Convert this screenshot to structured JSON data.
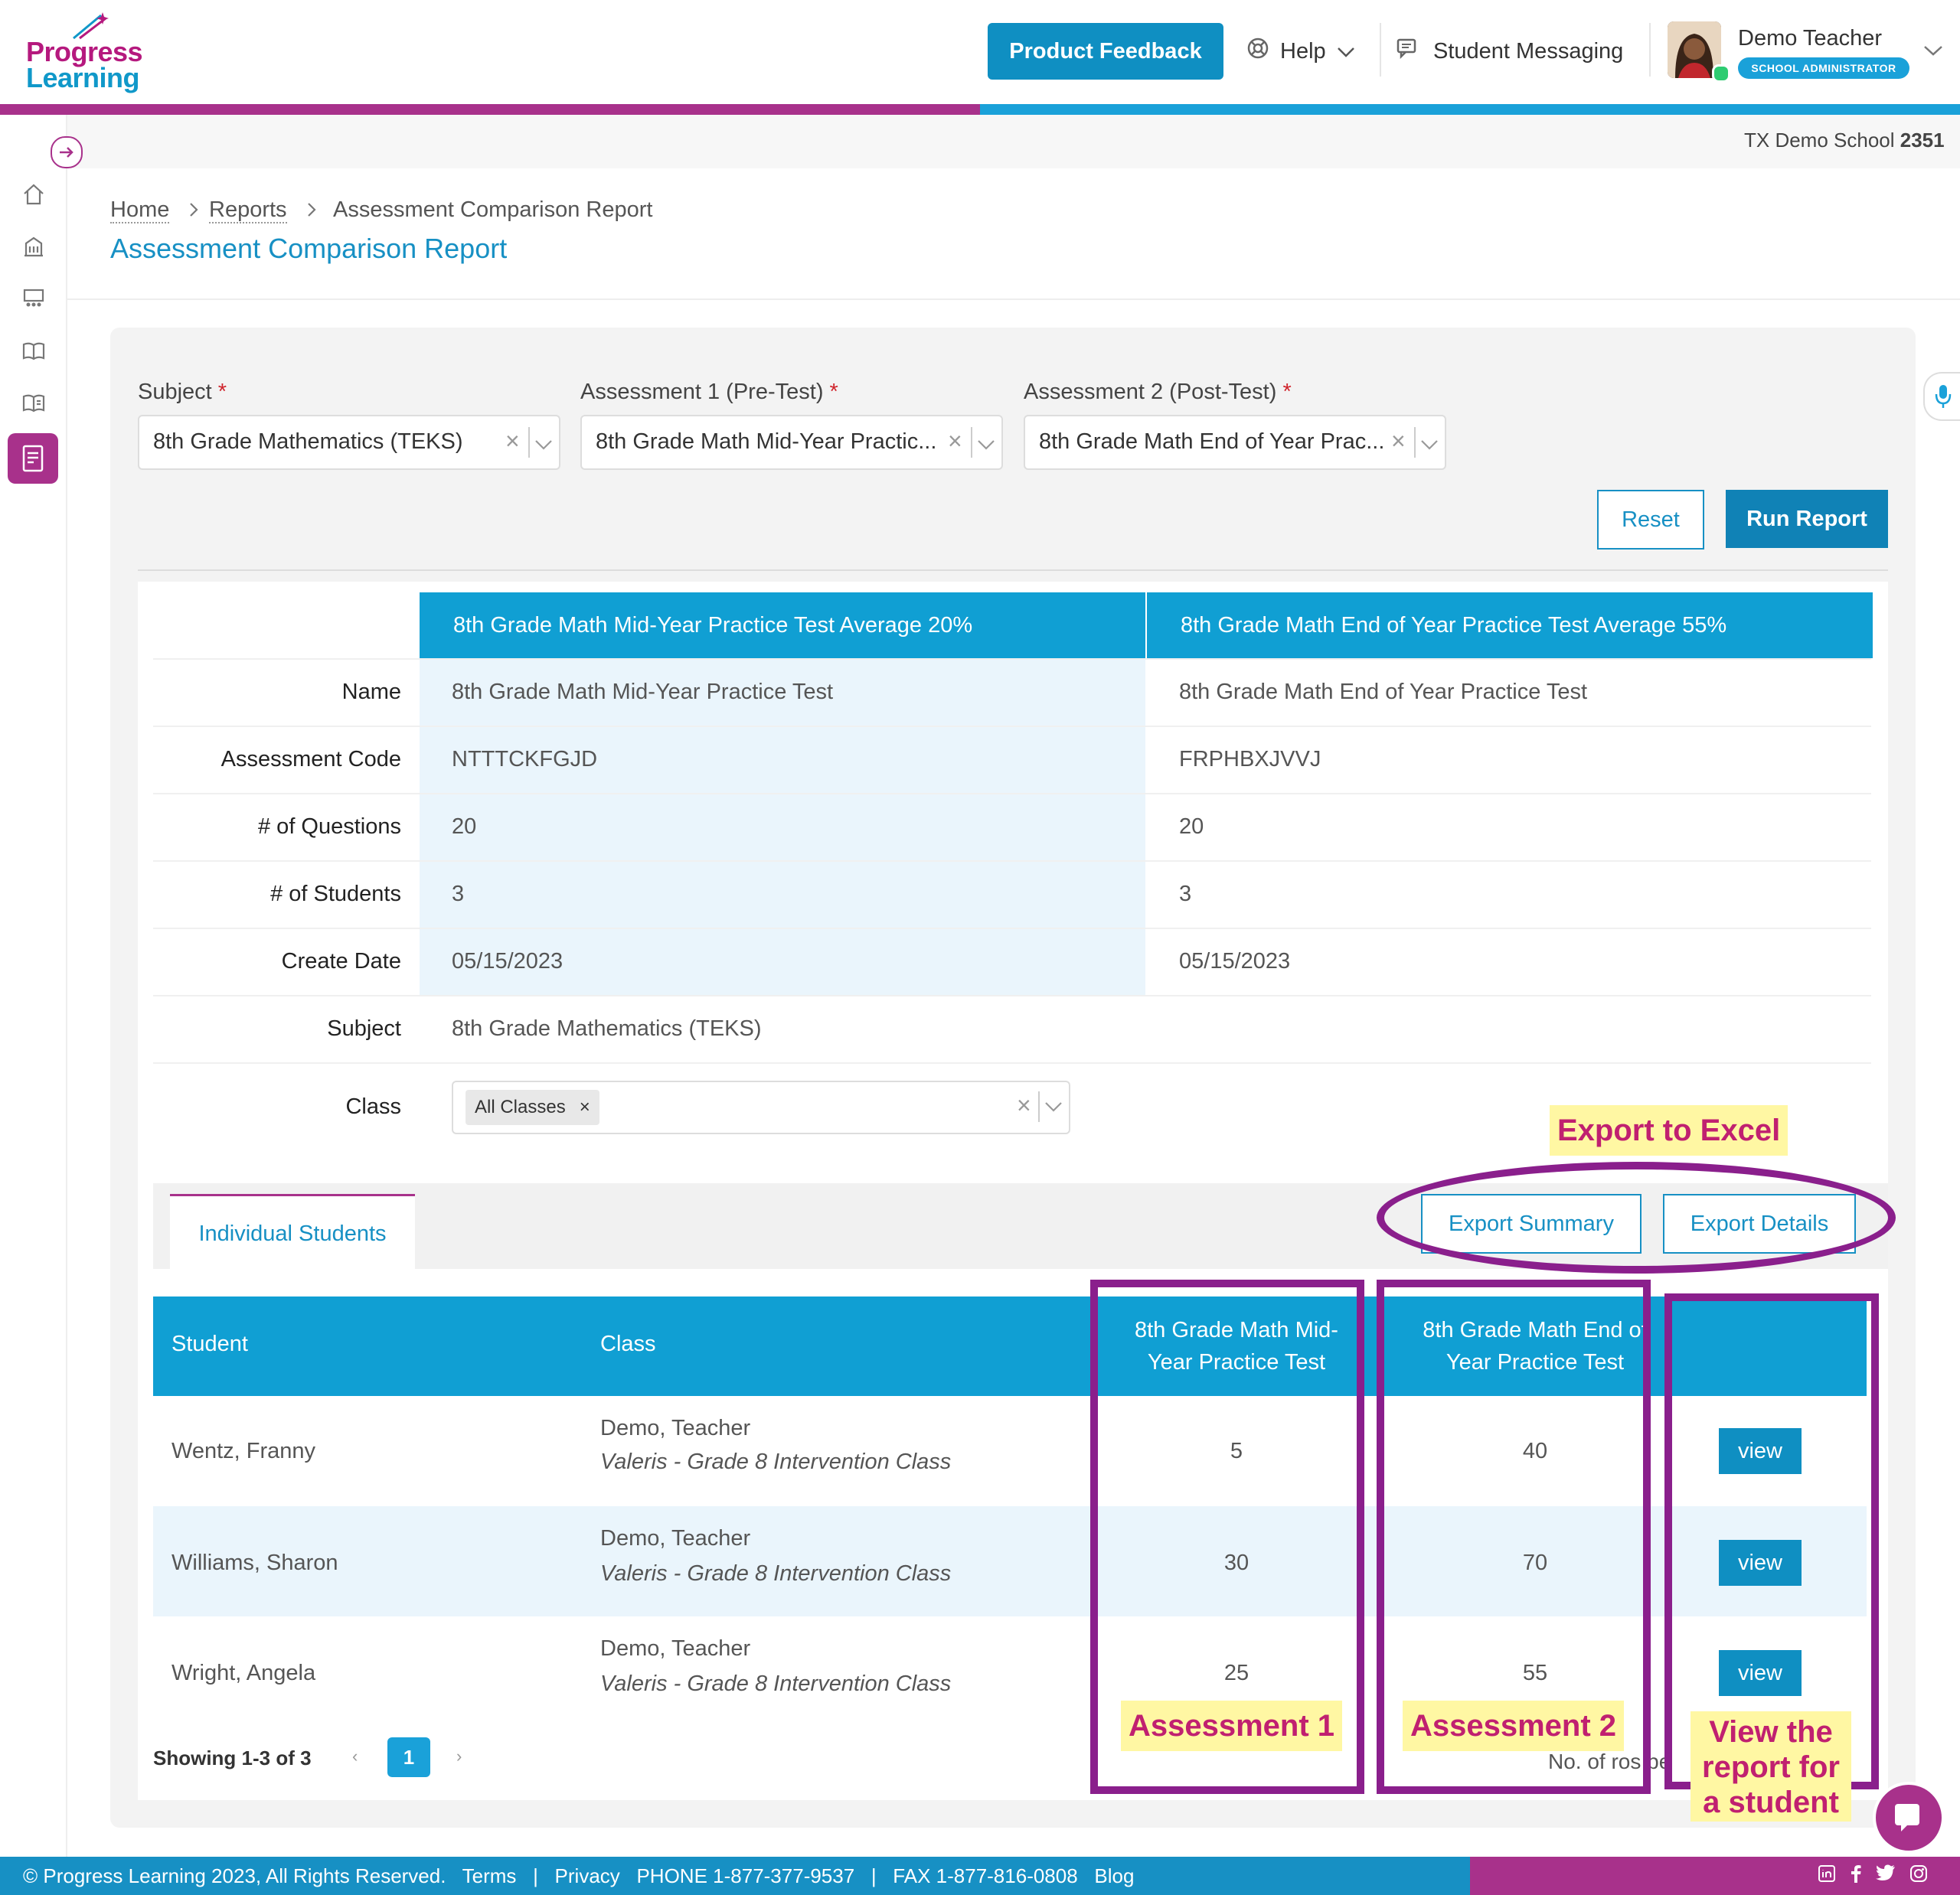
{
  "header": {
    "logo_top": "Progress",
    "logo_bottom": "Learning",
    "feedback_label": "Product Feedback",
    "help_label": "Help",
    "messaging_label": "Student Messaging",
    "user_name": "Demo Teacher",
    "user_role": "SCHOOL ADMINISTRATOR",
    "school_prefix": "TX Demo School",
    "school_number": "2351"
  },
  "breadcrumb": {
    "home": "Home",
    "reports": "Reports",
    "current": "Assessment Comparison Report"
  },
  "page_title": "Assessment Comparison Report",
  "filters": {
    "subject_label": "Subject",
    "subject_value": "8th Grade Mathematics (TEKS)",
    "a1_label": "Assessment 1 (Pre-Test)",
    "a1_value": "8th Grade Math Mid-Year Practic...",
    "a2_label": "Assessment 2 (Post-Test)",
    "a2_value": "8th Grade Math End of Year Prac...",
    "required_mark": "*",
    "reset_label": "Reset",
    "run_label": "Run Report"
  },
  "comparison": {
    "col_a_header": "8th Grade Math Mid-Year Practice Test Average 20%",
    "col_b_header": "8th Grade Math End of Year Practice Test Average 55%",
    "rows": [
      {
        "label": "Name",
        "a": "8th Grade Math Mid-Year Practice Test",
        "b": "8th Grade Math End of Year Practice Test"
      },
      {
        "label": "Assessment Code",
        "a": "NTTTCKFGJD",
        "b": "FRPHBXJVVJ"
      },
      {
        "label": "# of Questions",
        "a": "20",
        "b": "20"
      },
      {
        "label": "# of Students",
        "a": "3",
        "b": "3"
      },
      {
        "label": "Create Date",
        "a": "05/15/2023",
        "b": "05/15/2023"
      }
    ],
    "subject_label": "Subject",
    "subject_value": "8th Grade Mathematics (TEKS)",
    "class_label": "Class",
    "class_chip": "All Classes"
  },
  "tabs": {
    "individual": "Individual Students"
  },
  "exports": {
    "summary": "Export Summary",
    "details": "Export Details"
  },
  "students_table": {
    "headers": {
      "student": "Student",
      "class": "Class",
      "a1_line1": "8th Grade Math Mid-",
      "a1_line2": "Year Practice Test",
      "a2_line1": "8th Grade Math End of",
      "a2_line2": "Year Practice Test"
    },
    "rows": [
      {
        "name": "Wentz, Franny",
        "teacher": "Demo, Teacher",
        "class": "Valeris - Grade 8 Intervention Class",
        "a1": "5",
        "a2": "40",
        "action": "view"
      },
      {
        "name": "Williams, Sharon",
        "teacher": "Demo, Teacher",
        "class": "Valeris - Grade 8 Intervention Class",
        "a1": "30",
        "a2": "70",
        "action": "view"
      },
      {
        "name": "Wright, Angela",
        "teacher": "Demo, Teacher",
        "class": "Valeris - Grade 8 Intervention Class",
        "a1": "25",
        "a2": "55",
        "action": "view"
      }
    ],
    "showing": "Showing 1-3 of 3",
    "page": "1",
    "rows_per_page_partial": "No. of ro",
    "rows_per_page_partial2": "s pe"
  },
  "annotations": {
    "export": "Export to Excel",
    "assessment1": "Assessment 1",
    "assessment2": "Assessment 2",
    "view_line1": "View the",
    "view_line2": "report for",
    "view_line3": "a student"
  },
  "footer": {
    "copyright": "© Progress Learning 2023, All Rights Reserved.",
    "terms": "Terms",
    "privacy": "Privacy",
    "phone": "PHONE 1-877-377-9537",
    "fax": "FAX 1-877-816-0808",
    "blog": "Blog",
    "separator": "|"
  },
  "colors": {
    "brand_blue": "#109fd3",
    "brand_magenta": "#a8318b",
    "annotation_purple": "#8a1f8c",
    "annotation_yellow": "#fff7a3"
  }
}
